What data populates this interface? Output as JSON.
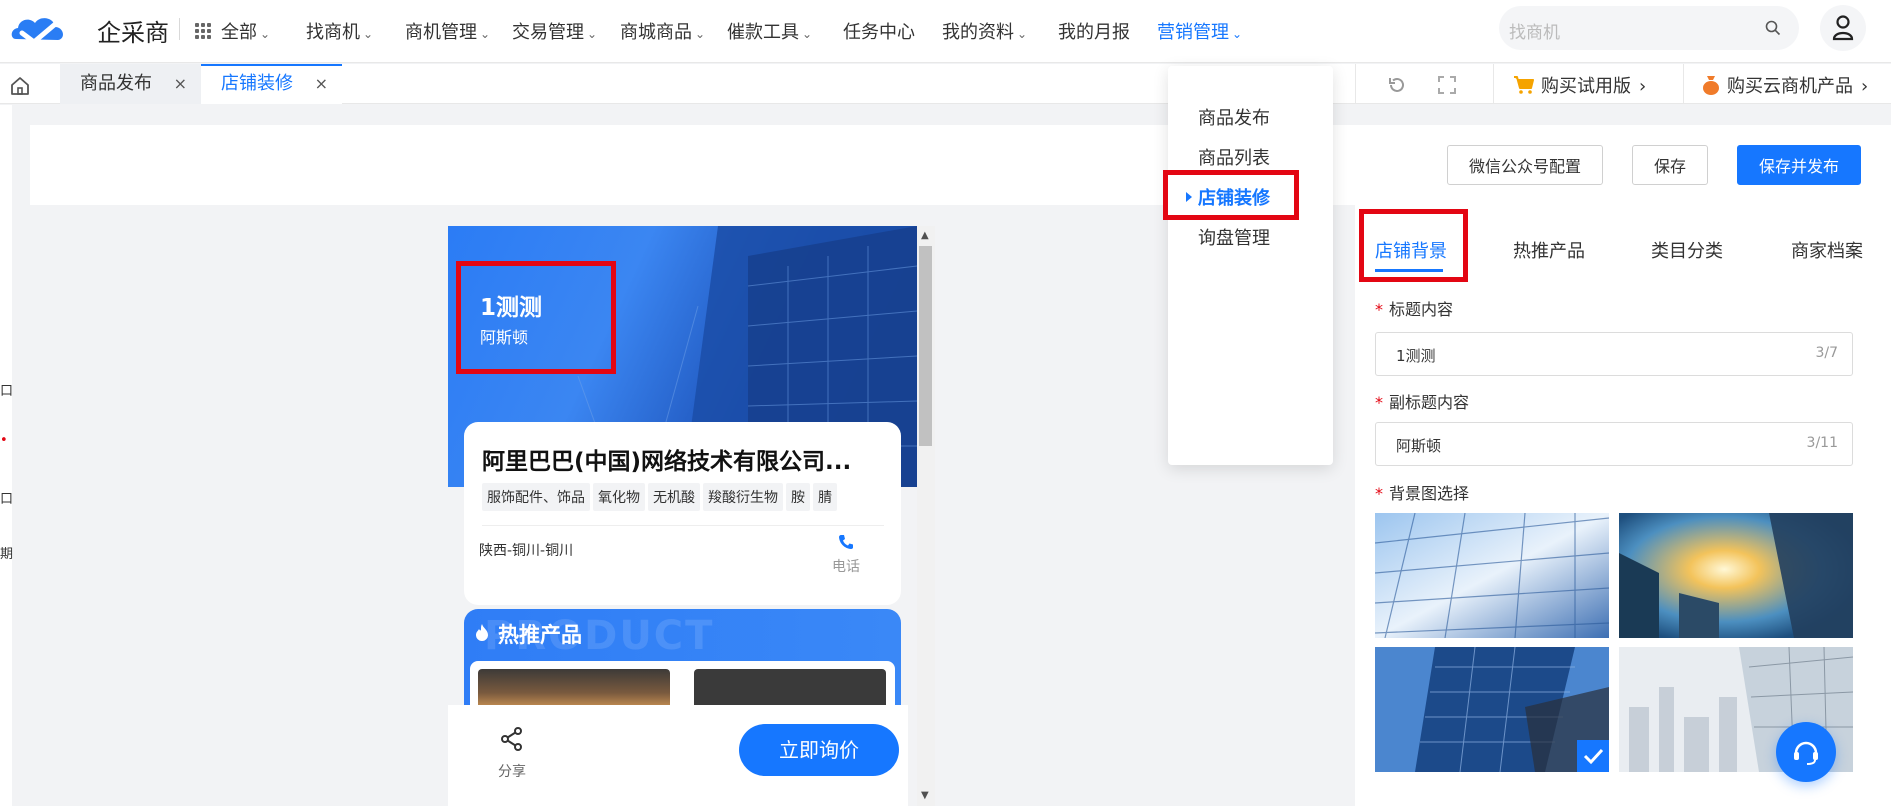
{
  "brand": {
    "name": "企采商"
  },
  "nav": {
    "items": [
      {
        "label": "全部",
        "caret": "⌄"
      },
      {
        "label": "找商机",
        "caret": "⌄"
      },
      {
        "label": "商机管理",
        "caret": "⌄"
      },
      {
        "label": "交易管理",
        "caret": "⌄"
      },
      {
        "label": "商城商品",
        "caret": "⌄"
      },
      {
        "label": "催款工具",
        "caret": "⌄"
      },
      {
        "label": "任务中心",
        "caret": ""
      },
      {
        "label": "我的资料",
        "caret": "⌄"
      },
      {
        "label": "我的月报",
        "caret": ""
      },
      {
        "label": "营销管理",
        "caret": "⌄"
      }
    ],
    "search_placeholder": "找商机"
  },
  "tabs": {
    "items": [
      {
        "label": "商品发布",
        "close": "×"
      },
      {
        "label": "店铺装修",
        "close": "×"
      }
    ],
    "buy_trial": "购买试用版",
    "buy_cloud": "购买云商机产品",
    "arrow": "›"
  },
  "actions": {
    "wechat_config": "微信公众号配置",
    "save": "保存",
    "save_publish": "保存并发布"
  },
  "preview": {
    "hero_title": "1测测",
    "hero_subtitle": "阿斯顿",
    "company_name": "阿里巴巴(中国)网络技术有限公司...",
    "tags": [
      "服饰配件、饰品",
      "氧化物",
      "无机酸",
      "羧酸衍生物",
      "胺",
      "腈"
    ],
    "location": "陕西-铜川-铜川",
    "phone_label": "电话",
    "hot_watermark": "PRODUCT",
    "hot_title": "热推产品",
    "share_label": "分享",
    "inquiry_label": "立即询价"
  },
  "dropdown": {
    "items": [
      "商品发布",
      "商品列表",
      "店铺装修",
      "询盘管理"
    ],
    "active_index": 2
  },
  "panel": {
    "tabs": [
      "店铺背景",
      "热推产品",
      "类目分类",
      "商家档案"
    ],
    "active_tab": 0,
    "required_mark": "*",
    "title_label": "标题内容",
    "title_value": "1测测",
    "title_count": "3/7",
    "subtitle_label": "副标题内容",
    "subtitle_value": "阿斯顿",
    "subtitle_count": "3/11",
    "bg_label": "背景图选择",
    "selected_bg_index": 2
  },
  "left_strip_marks": [
    "口",
    "•",
    "口",
    "期"
  ],
  "colors": {
    "accent": "#1677ff",
    "highlight_box": "#e30613",
    "text": "#333333",
    "muted": "#999999"
  }
}
